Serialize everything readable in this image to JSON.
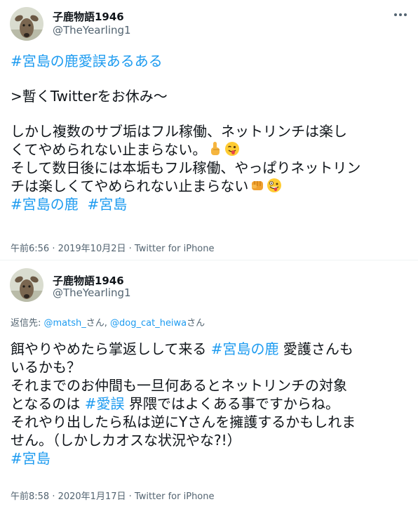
{
  "colors": {
    "link": "#1d9bf0",
    "secondary_text": "#536471",
    "primary_text": "#0f1419"
  },
  "tweets": [
    {
      "author": {
        "name": "子鹿物語1946",
        "handle": "@TheYearling1"
      },
      "menu_icon": "more-dots-icon",
      "lines": [
        {
          "tag": "#宮島の鹿愛誤あるある"
        },
        {
          "text": ">暫くTwitterをお休み〜"
        },
        {
          "text": "しかし複数のサブ垢はフル稼働、ネットリンチは楽し"
        },
        {
          "text": "くてやめられない止まらない。",
          "emojis": [
            "pointing-finger-emoji",
            "winking-tongue-emoji"
          ]
        },
        {
          "text": "そして数日後には本垢もフル稼働、やっぱりネットリン"
        },
        {
          "text": "チは楽しくてやめられない止まらない",
          "emojis": [
            "fist-emoji",
            "zany-face-emoji"
          ]
        },
        {
          "tags": [
            "#宮島の鹿",
            "#宮島"
          ]
        }
      ],
      "timestamp": "午前6:56 · 2019年10月2日",
      "separator": " · ",
      "source": "Twitter for iPhone"
    },
    {
      "author": {
        "name": "子鹿物語1946",
        "handle": "@TheYearling1"
      },
      "reply": {
        "prefix": "返信先: ",
        "mention1": "@matsh_",
        "mid": "さん, ",
        "mention2": "@dog_cat_heiwa",
        "suffix": "さん"
      },
      "lines": [
        {
          "before": "餌やりやめたら掌返しして来る ",
          "tag": "#宮島の鹿",
          "after": " 愛護さんも"
        },
        {
          "text": "いるかも？"
        },
        {
          "text": "それまでのお仲間も一旦何あるとネットリンチの対象"
        },
        {
          "before": "となるのは ",
          "tag": "#愛誤",
          "after": " 界隈ではよくある事ですからね。"
        },
        {
          "text": "それやり出したら私は逆にYさんを擁護するかもしれま"
        },
        {
          "text": "せん。（しかしカオスな状況やな?!）"
        },
        {
          "tag": "#宮島"
        }
      ],
      "timestamp": "午前8:58 · 2020年1月17日",
      "separator": " · ",
      "source": "Twitter for iPhone"
    }
  ]
}
